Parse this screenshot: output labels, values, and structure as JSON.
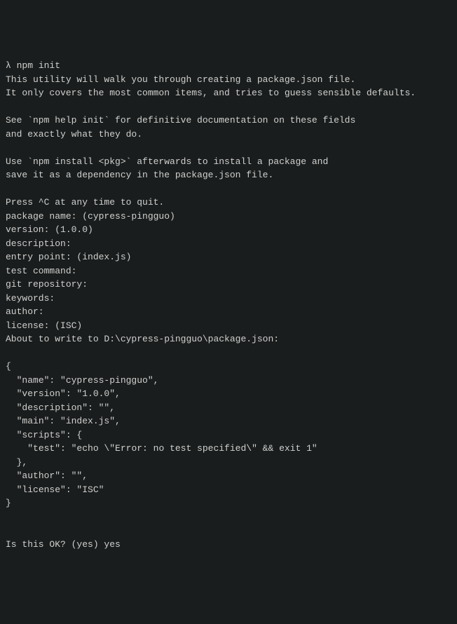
{
  "terminal": {
    "prompt": "λ",
    "command": "npm init",
    "intro_line1": "This utility will walk you through creating a package.json file.",
    "intro_line2": "It only covers the most common items, and tries to guess sensible defaults.",
    "help_line1": "See `npm help init` for definitive documentation on these fields",
    "help_line2": "and exactly what they do.",
    "install_line1": "Use `npm install <pkg>` afterwards to install a package and",
    "install_line2": "save it as a dependency in the package.json file.",
    "ctrl_c": "Press ^C at any time to quit.",
    "prompt_package_name": "package name: (cypress-pingguo)",
    "prompt_version": "version: (1.0.0)",
    "prompt_description": "description:",
    "prompt_entry": "entry point: (index.js)",
    "prompt_test": "test command:",
    "prompt_git": "git repository:",
    "prompt_keywords": "keywords:",
    "prompt_author": "author:",
    "prompt_license": "license: (ISC)",
    "about_to_write": "About to write to D:\\cypress-pingguo\\package.json:",
    "json_open": "{",
    "json_name": "  \"name\": \"cypress-pingguo\",",
    "json_version": "  \"version\": \"1.0.0\",",
    "json_description": "  \"description\": \"\",",
    "json_main": "  \"main\": \"index.js\",",
    "json_scripts_open": "  \"scripts\": {",
    "json_test": "    \"test\": \"echo \\\"Error: no test specified\\\" && exit 1\"",
    "json_scripts_close": "  },",
    "json_author": "  \"author\": \"\",",
    "json_license": "  \"license\": \"ISC\"",
    "json_close": "}",
    "confirm": "Is this OK? (yes) yes"
  }
}
